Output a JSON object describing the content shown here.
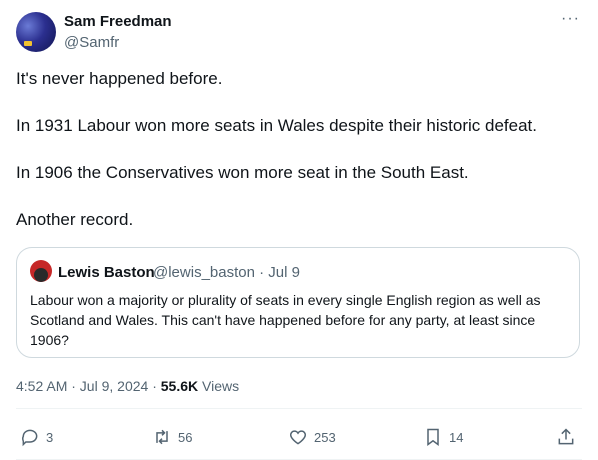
{
  "author": {
    "name": "Sam Freedman",
    "handle": "@Samfr"
  },
  "tweet": {
    "paragraphs": [
      "It's never happened before.",
      "In 1931 Labour won more seats in Wales despite their historic defeat.",
      "In 1906 the Conservatives won more seat in the South East.",
      "Another record."
    ]
  },
  "quote": {
    "name": "Lewis Baston",
    "handle_date": "@lewis_baston · Jul 9",
    "text": "Labour won a majority or plurality of seats in every single English region as well as Scotland and Wales. This can't have happened before for any party, at least since 1906?"
  },
  "meta": {
    "time": "4:52 AM · Jul 9, 2024 · ",
    "views_count": "55.6K",
    "views_label": " Views"
  },
  "actions": {
    "replies": "3",
    "reposts": "56",
    "likes": "253",
    "bookmarks": "14"
  },
  "icons": [
    "more-icon",
    "reply-icon",
    "repost-icon",
    "like-icon",
    "bookmark-icon",
    "share-icon"
  ]
}
